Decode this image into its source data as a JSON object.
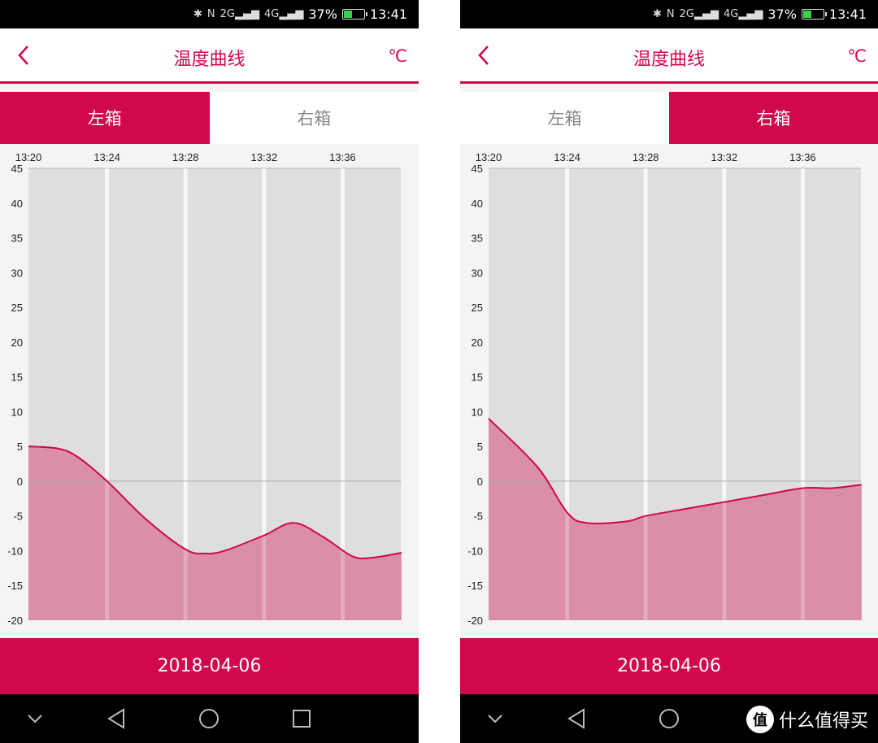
{
  "colors": {
    "accent": "#d0094a",
    "fill": "#db8fa7",
    "plot_bg": "#dedede",
    "panel_bg": "#f4f4f4",
    "zero_line": "#aaaaaa"
  },
  "statusbar": {
    "bluetooth": "bluetooth-icon",
    "nfc": "N",
    "net1": "2G",
    "net2": "4G",
    "battery": "37%",
    "battery_level": 0.37,
    "time": "13:41"
  },
  "appbar": {
    "title": "温度曲线",
    "unit": "℃",
    "back_icon": "chevron-left-icon"
  },
  "tabs": [
    "左箱",
    "右箱"
  ],
  "date": "2018-04-06",
  "navbar": [
    "chevron-down-icon",
    "back-triangle-icon",
    "home-circle-icon",
    "recents-square-icon"
  ],
  "watermark": {
    "logo": "值",
    "text": "什么值得买"
  },
  "screens": [
    {
      "active_tab": 0
    },
    {
      "active_tab": 1
    }
  ],
  "chart_data": [
    {
      "type": "area",
      "title": "温度曲线 - 左箱",
      "xlabel": "",
      "ylabel": "",
      "x_ticks": [
        "13:20",
        "13:24",
        "13:28",
        "13:32",
        "13:36"
      ],
      "x_unit": "minutes after 13:20",
      "xlim": [
        0,
        19
      ],
      "y_ticks": [
        45,
        40,
        35,
        30,
        25,
        20,
        15,
        10,
        5,
        0,
        -5,
        -10,
        -15,
        -20
      ],
      "ylim": [
        -20,
        45
      ],
      "grid": "vertical bands",
      "series": [
        {
          "name": "左箱",
          "x": [
            0,
            1.5,
            2.5,
            4,
            6,
            8,
            9,
            10,
            12,
            13.5,
            15,
            16.5,
            17.5,
            19
          ],
          "values": [
            5,
            4.7,
            3.5,
            0,
            -5.5,
            -9.8,
            -10.4,
            -10,
            -7.8,
            -6,
            -8,
            -10.8,
            -11,
            -10.3
          ]
        }
      ]
    },
    {
      "type": "area",
      "title": "温度曲线 - 右箱",
      "xlabel": "",
      "ylabel": "",
      "x_ticks": [
        "13:20",
        "13:24",
        "13:28",
        "13:32",
        "13:36"
      ],
      "x_unit": "minutes after 13:20",
      "xlim": [
        0,
        19
      ],
      "y_ticks": [
        45,
        40,
        35,
        30,
        25,
        20,
        15,
        10,
        5,
        0,
        -5,
        -10,
        -15,
        -20
      ],
      "ylim": [
        -20,
        45
      ],
      "grid": "vertical bands",
      "series": [
        {
          "name": "右箱",
          "x": [
            0,
            2.5,
            4,
            5,
            7,
            8,
            10,
            12,
            14,
            16,
            17.5,
            19
          ],
          "values": [
            9,
            2,
            -4.5,
            -6,
            -5.8,
            -5,
            -4,
            -3,
            -2,
            -1,
            -1,
            -0.5
          ]
        }
      ]
    }
  ]
}
